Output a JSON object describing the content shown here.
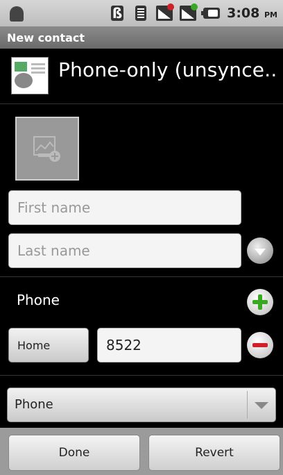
{
  "status_bar": {
    "time": "3:08",
    "ampm": "PM",
    "icons": [
      "android-icon",
      "bluetooth-icon",
      "wifi-icon",
      "signal-icon",
      "signal-icon",
      "battery-icon"
    ],
    "badge_red": "#d0202a",
    "badge_green": "#3aa822"
  },
  "title_bar": {
    "title": "New contact"
  },
  "account": {
    "name": "Phone-only (unsynce..."
  },
  "name_fields": {
    "first_placeholder": "First name",
    "last_placeholder": "Last name"
  },
  "phone_section": {
    "label": "Phone",
    "entries": [
      {
        "type": "Home",
        "value": "8522"
      }
    ],
    "add_color": "#3aa822",
    "remove_color": "#d0202a"
  },
  "add_field_spinner": {
    "label": "Phone"
  },
  "bottom_bar": {
    "done_label": "Done",
    "revert_label": "Revert"
  }
}
